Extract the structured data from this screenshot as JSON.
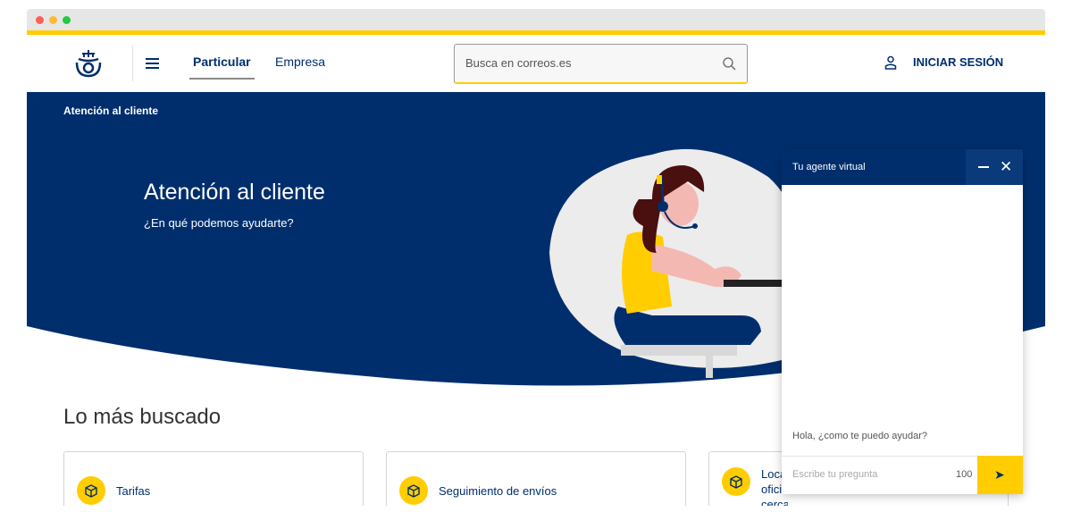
{
  "header": {
    "tabs": [
      {
        "label": "Particular",
        "active": true
      },
      {
        "label": "Empresa",
        "active": false
      }
    ],
    "search": {
      "placeholder": "Busca en correos.es",
      "value": ""
    },
    "login_label": "INICIAR SESIÓN"
  },
  "hero": {
    "breadcrumb": "Atención al cliente",
    "title": "Atención al cliente",
    "subtitle": "¿En qué podemos ayudarte?"
  },
  "most_searched": {
    "title": "Lo más buscado",
    "cards": [
      {
        "label": "Tarifas",
        "icon": "package-icon"
      },
      {
        "label": "Seguimiento de envíos",
        "icon": "package-icon"
      },
      {
        "label": "Localiza oficinas cercanas",
        "icon": "package-icon"
      }
    ]
  },
  "chat": {
    "title": "Tu agente virtual",
    "greeting": "Hola, ¿como te puedo ayudar?",
    "input_placeholder": "Escribe tu pregunta",
    "char_count": "100"
  },
  "colors": {
    "brand_blue": "#002e6d",
    "brand_yellow": "#ffcd00"
  }
}
